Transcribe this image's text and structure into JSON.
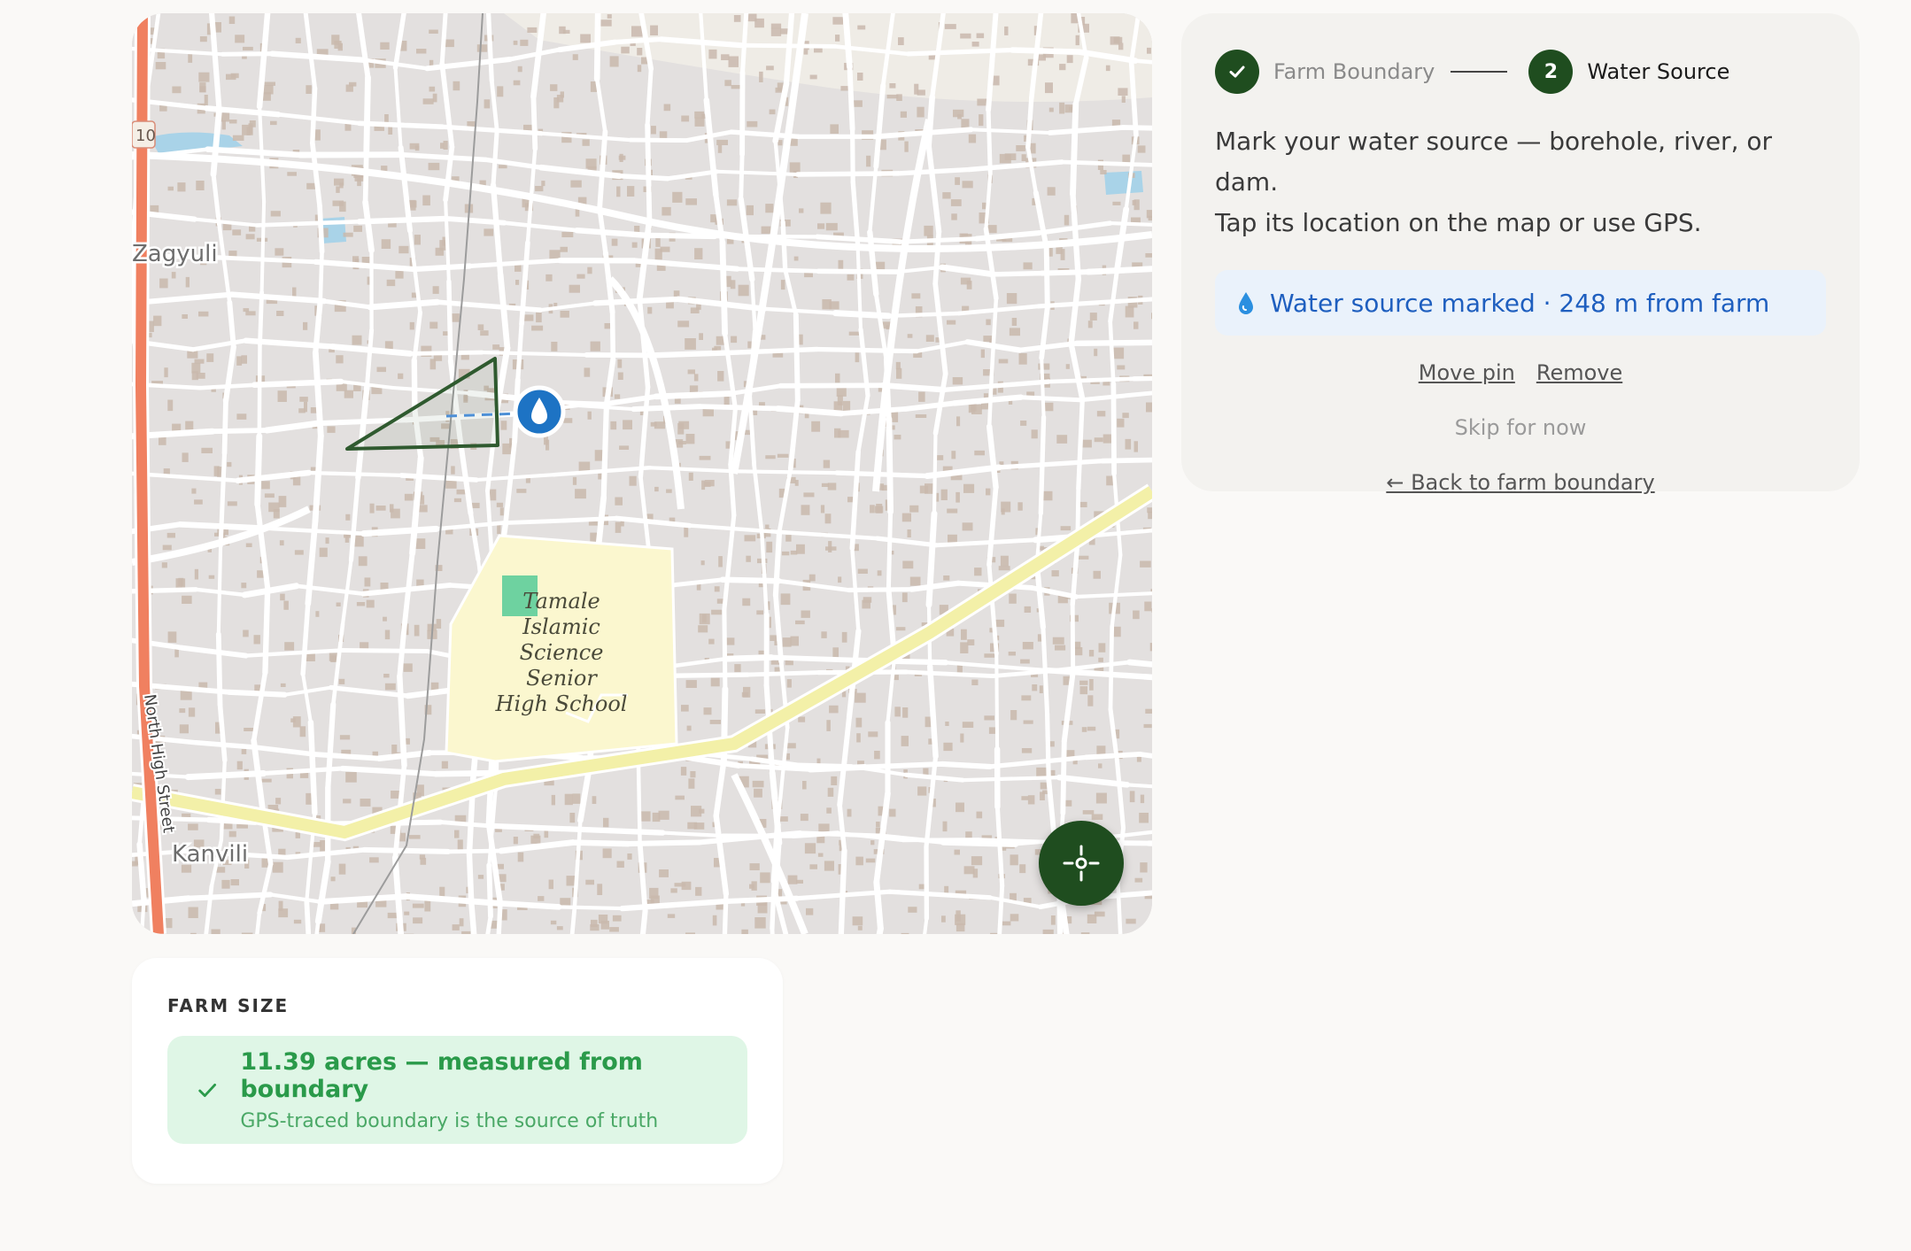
{
  "map": {
    "labels": {
      "zagyuli": "Zagyuli",
      "kanvili": "Kanvili",
      "street": "North High Street",
      "school_lines": [
        "Tamale",
        "Islamic",
        "Science",
        "Senior",
        "High School"
      ],
      "road_badge": "10"
    },
    "colors": {
      "background": "#e3e0df",
      "road": "#ffffff",
      "main_road": "#f3f0a8",
      "side_road": "#f08060",
      "building": "#c9b9ad",
      "school_area": "#fbf7cf",
      "park": "#6ed2a0",
      "water": "#a9d3e8",
      "boundary": "#2f5a2f",
      "pin": "#1d73c4"
    },
    "icons": {
      "water_pin": "water-drop-pin-icon",
      "gps": "crosshair-icon"
    }
  },
  "stepper": {
    "step1_label": "Farm Boundary",
    "step1_icon": "check-icon",
    "step2_number": "2",
    "step2_label": "Water Source"
  },
  "panel": {
    "instruction_line1": "Mark your water source — borehole, river, or dam.",
    "instruction_line2": "Tap its location on the map or use GPS.",
    "status_text": "Water source marked · 248 m from farm",
    "move_pin": "Move pin",
    "remove": "Remove",
    "skip": "Skip for now",
    "back": "← Back to farm boundary"
  },
  "farm_size": {
    "title": "FARM SIZE",
    "main": "11.39 acres — measured from boundary",
    "sub": "GPS-traced boundary is the source of truth"
  },
  "colors": {
    "accent_green": "#1f4d1f",
    "status_blue": "#1f5fbf",
    "success_green": "#2a9a4a"
  }
}
